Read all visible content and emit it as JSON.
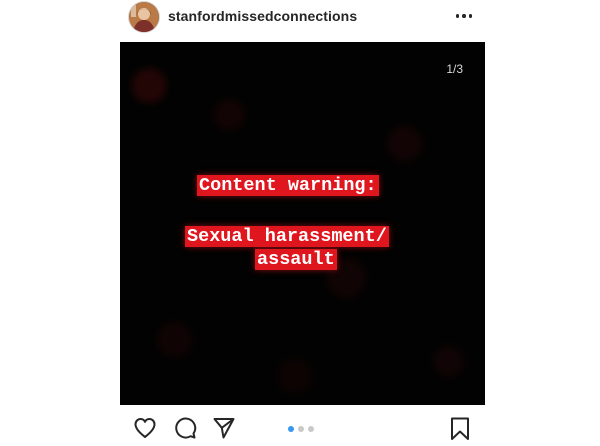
{
  "post": {
    "username": "stanfordmissedconnections",
    "more_options_icon": "more-horizontal-icon",
    "avatar_icon": "profile-avatar"
  },
  "media": {
    "page_counter": "1/3",
    "current_slide": 1,
    "total_slides": 3,
    "warning_title": "Content warning:",
    "warning_subject_line1": "Sexual harassment/",
    "warning_subject_line2": "assault",
    "highlight_color": "#e0161f",
    "background_color": "#030202"
  },
  "actions": {
    "like_icon": "heart-icon",
    "comment_icon": "comment-bubble-icon",
    "share_icon": "paper-plane-icon",
    "save_icon": "bookmark-icon"
  },
  "carousel": {
    "dot_count": 3,
    "active_index": 0,
    "active_color": "#3897f0",
    "inactive_color": "#c9c9c9"
  }
}
